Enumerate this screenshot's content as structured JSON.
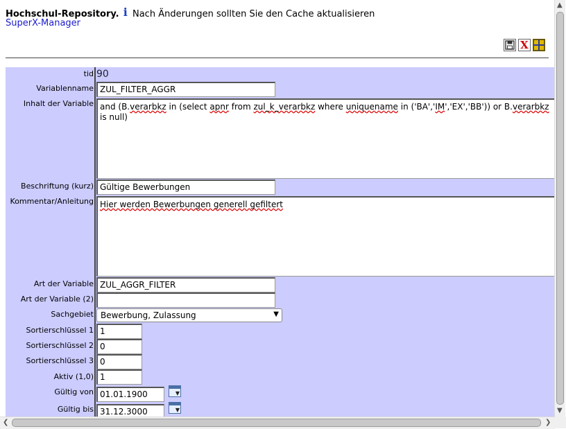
{
  "header": {
    "title": "Hochschul-Repository.",
    "info_glyph": "i",
    "notice": "Nach Änderungen sollten Sie den Cache aktualisieren",
    "manager_link": "SuperX-Manager"
  },
  "toolbar": {
    "icons": [
      "save-icon",
      "delete-icon",
      "grid-icon"
    ],
    "delete_glyph": "X",
    "colors": {
      "delete": "#cc0000",
      "grid": "#e0b800",
      "save": "#333333"
    }
  },
  "form": {
    "background": "#ccccff",
    "tid": {
      "label": "tid",
      "value": "90"
    },
    "variablenname": {
      "label": "Variablenname",
      "value": "ZUL_FILTER_AGGR"
    },
    "inhalt": {
      "label": "Inhalt der Variable",
      "value_parts": [
        "and (B.",
        "verarbkz",
        " in (select ",
        "apnr",
        " from ",
        "zul_k_verarbkz",
        " where ",
        "uniquename",
        " in ('BA','",
        "IM",
        "','EX','BB')) or B.",
        "verarbkz",
        " is null)"
      ]
    },
    "beschriftung": {
      "label": "Beschriftung (kurz)",
      "value": "Gültige Bewerbungen"
    },
    "kommentar": {
      "label": "Kommentar/Anleitung",
      "value": "Hier werden Bewerbungen generell gefiltert"
    },
    "art": {
      "label": "Art der Variable",
      "value": "ZUL_AGGR_FILTER"
    },
    "art2": {
      "label": "Art der Variable (2)",
      "value": ""
    },
    "sachgebiet": {
      "label": "Sachgebiet",
      "selected": "Bewerbung, Zulassung"
    },
    "sort1": {
      "label": "Sortierschlüssel 1",
      "value": "1"
    },
    "sort2": {
      "label": "Sortierschlüssel 2",
      "value": "0"
    },
    "sort3": {
      "label": "Sortierschlüssel 3",
      "value": "0"
    },
    "aktiv": {
      "label": "Aktiv (1,0)",
      "value": "1"
    },
    "gueltig_von": {
      "label": "Gültig von",
      "value": "01.01.1900"
    },
    "gueltig_bis": {
      "label": "Gültig bis",
      "value": "31.12.3000"
    }
  }
}
